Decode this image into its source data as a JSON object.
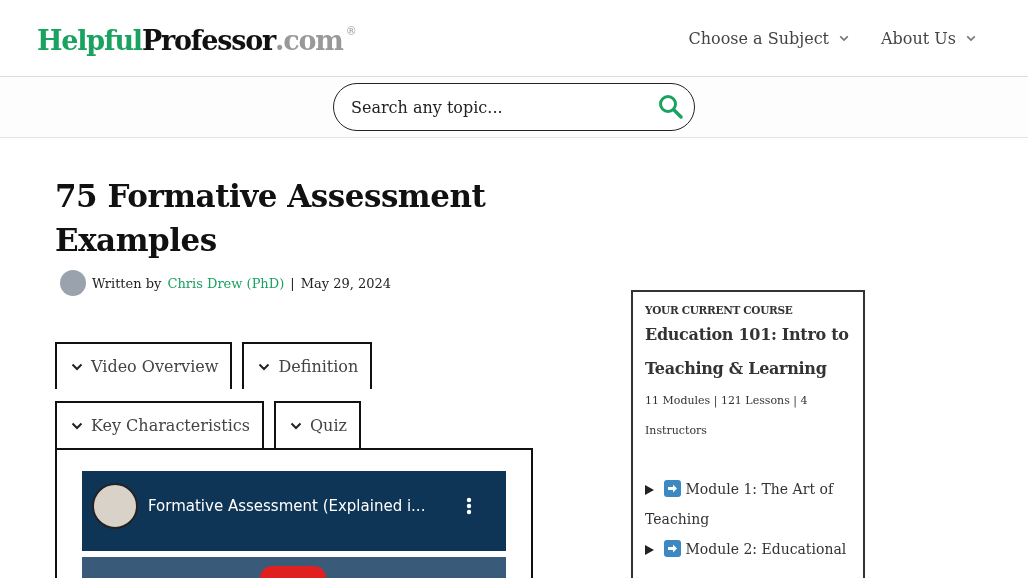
{
  "header": {
    "logo": {
      "part_1": "Helpful",
      "part_2": "Professor",
      "part_3": ".com",
      "mark": "®"
    },
    "nav": [
      {
        "label": "Choose a Subject"
      },
      {
        "label": "About Us"
      }
    ]
  },
  "search": {
    "placeholder": "Search any topic..."
  },
  "article": {
    "title": "75 Formative Assessment Examples",
    "byline": {
      "prefix": "Written by",
      "author": "Chris Drew (PhD)",
      "separator": "|",
      "date": "May 29, 2024"
    },
    "tabs": [
      {
        "label": "Video Overview"
      },
      {
        "label": "Definition"
      },
      {
        "label": "Key Characteristics"
      },
      {
        "label": "Quiz"
      }
    ],
    "video": {
      "title": "Formative Assessment (Explained i..."
    }
  },
  "sidebar": {
    "eyebrow": "YOUR CURRENT COURSE",
    "course_title": "Education 101: Intro to Teaching & Learning",
    "stats": "11 Modules | 121 Lessons | 4 Instructors",
    "modules": [
      {
        "label": "Module 1: The Art of Teaching",
        "expanded": false
      },
      {
        "label": "Module 2: Educational",
        "expanded": false
      }
    ]
  }
}
